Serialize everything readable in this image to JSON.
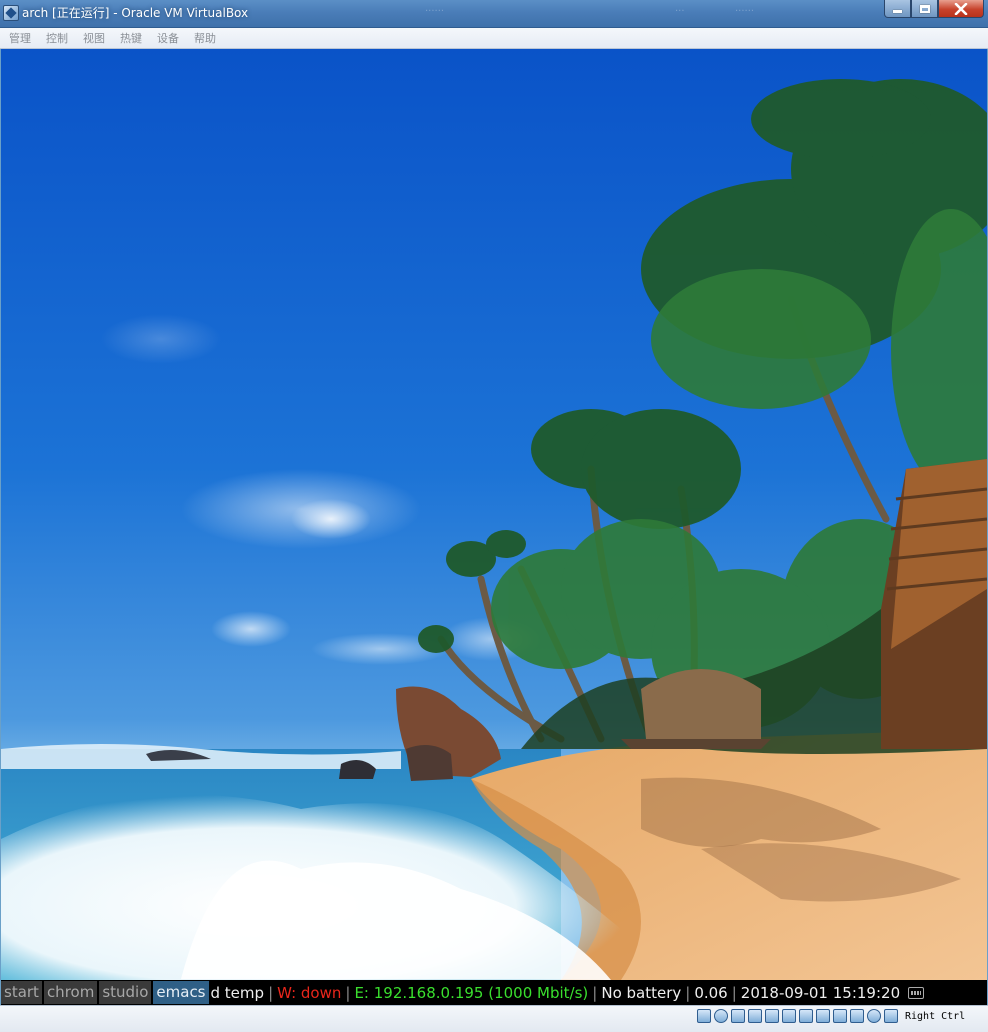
{
  "window": {
    "title": "arch [正在运行] - Oracle VM VirtualBox",
    "ghost_tabs": [
      "······",
      "···",
      "······"
    ],
    "controls": {
      "minimize": "minimize",
      "maximize": "maximize",
      "close": "close"
    }
  },
  "menubar": {
    "items": [
      "管理",
      "控制",
      "视图",
      "热键",
      "设备",
      "帮助"
    ]
  },
  "guest": {
    "wallpaper": "tropical-beach-with-palm-trees",
    "workspaces": [
      {
        "label": "start",
        "active": false
      },
      {
        "label": "chrom",
        "active": false
      },
      {
        "label": "studio",
        "active": false
      },
      {
        "label": "emacs",
        "active": true
      }
    ],
    "status": {
      "temp": "d temp",
      "wifi": "W: down",
      "ethernet": "E: 192.168.0.195 (1000 Mbit/s)",
      "battery": "No battery",
      "load": "0.06",
      "datetime": "2018-09-01 15:19:20",
      "separator": "|"
    },
    "colors": {
      "bar_bg": "#000000",
      "active_ws": "#2f5f86",
      "down": "#e8261b",
      "up": "#3adf2e"
    }
  },
  "host": {
    "tray_icons": [
      "hard-disk-icon",
      "optical-drive-icon",
      "audio-icon",
      "network-icon",
      "usb-icon",
      "shared-folder-icon",
      "display-icon",
      "video-capture-icon",
      "vrde-icon",
      "cpu-icon",
      "mouse-integration-icon",
      "keyboard-arrow-icon"
    ],
    "host_key": "Right Ctrl"
  }
}
